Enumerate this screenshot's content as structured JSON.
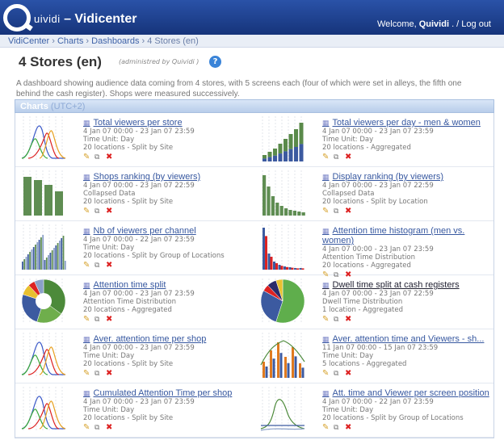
{
  "brand": {
    "quividi": "uividi",
    "app": " – Vidicenter"
  },
  "header": {
    "welcome": "Welcome,",
    "user": "Quividi",
    "logout": ". / Log out"
  },
  "breadcrumb": [
    "VidiCenter",
    "Charts",
    "Dashboards",
    "4 Stores (en)"
  ],
  "page": {
    "title": "4 Stores (en)",
    "admin": "(administred by Quividi )",
    "help": "?",
    "description": "A dashboard showing audience data coming from 4 stores, with 5 screens each (four of which were set in alleys, the fifth one behind the cash register). Shops were measured successively."
  },
  "charts_header": {
    "label": "Charts",
    "tz": "(UTC+2)"
  },
  "charts": [
    {
      "title": "Total viewers per store",
      "dates": "4 Jan 07 00:00 - 23 Jan 07 23:59",
      "unit": "Time Unit: Day",
      "scope": "20 locations - Split by Site",
      "thumb": "lines"
    },
    {
      "title": "Total viewers per day - men & women",
      "dates": "4 Jan 07 00:00 - 23 Jan 07 23:59",
      "unit": "Time Unit: Day",
      "scope": "20 locations - Aggregated",
      "thumb": "stackbars"
    },
    {
      "title": "Shops ranking (by viewers)",
      "dates": "4 Jan 07 00:00 - 23 Jan 07 22:59",
      "unit": "Collapsed Data",
      "scope": "20 locations - Split by Site",
      "thumb": "greenbars"
    },
    {
      "title": "Display ranking (by viewers)",
      "dates": "4 Jan 07 00:00 - 23 Jan 07 22:59",
      "unit": "Collapsed Data",
      "scope": "20 locations - Split by Location",
      "thumb": "greenbars2"
    },
    {
      "title": "Nb of viewers per channel",
      "dates": "4 Jan 07 00:00 - 22 Jan 07 23:59",
      "unit": "Time Unit: Day",
      "scope": "20 locations - Split by Group of Locations",
      "thumb": "multibars"
    },
    {
      "title": "Attention time histogram (men vs. women)",
      "dates": "4 Jan 07 00:00 - 23 Jan 07 23:59",
      "unit": "Attention Time Distribution",
      "scope": "20 locations - Aggregated",
      "thumb": "histogram"
    },
    {
      "title": "Attention time split",
      "dates": "4 Jan 07 00:00 - 23 Jan 07 23:59",
      "unit": "Attention Time Distribution",
      "scope": "20 locations - Aggregated",
      "thumb": "donut"
    },
    {
      "title": "Dwell time split at cash registers",
      "dates": "4 Jan 07 00:00 - 23 Jan 07 22:59",
      "unit": "Dwell Time Distribution",
      "scope": "1 location - Aggregated",
      "thumb": "pie",
      "underline": true
    },
    {
      "title": "Aver. attention time per shop",
      "dates": "4 Jan 07 00:00 - 23 Jan 07 23:59",
      "unit": "Time Unit: Day",
      "scope": "20 locations - Split by Site",
      "thumb": "lines"
    },
    {
      "title": "Aver. attention time and Viewers - sh...",
      "dates": "11 Jan 07 00:00 - 15 Jan 07 23:59",
      "unit": "Time Unit: Day",
      "scope": "5 locations - Aggregated",
      "thumb": "combo"
    },
    {
      "title": "Cumulated Attention Time per shop",
      "dates": "4 Jan 07 00:00 - 23 Jan 07 23:59",
      "unit": "Time Unit: Day",
      "scope": "20 locations - Split by Site",
      "thumb": "lines"
    },
    {
      "title": "Att. time and Viewer per screen position",
      "dates": "4 Jan 07 00:00 - 22 Jan 07 23:59",
      "unit": "Time Unit: Day",
      "scope": "20 locations - Split by Group of Locations",
      "thumb": "greenline"
    }
  ]
}
